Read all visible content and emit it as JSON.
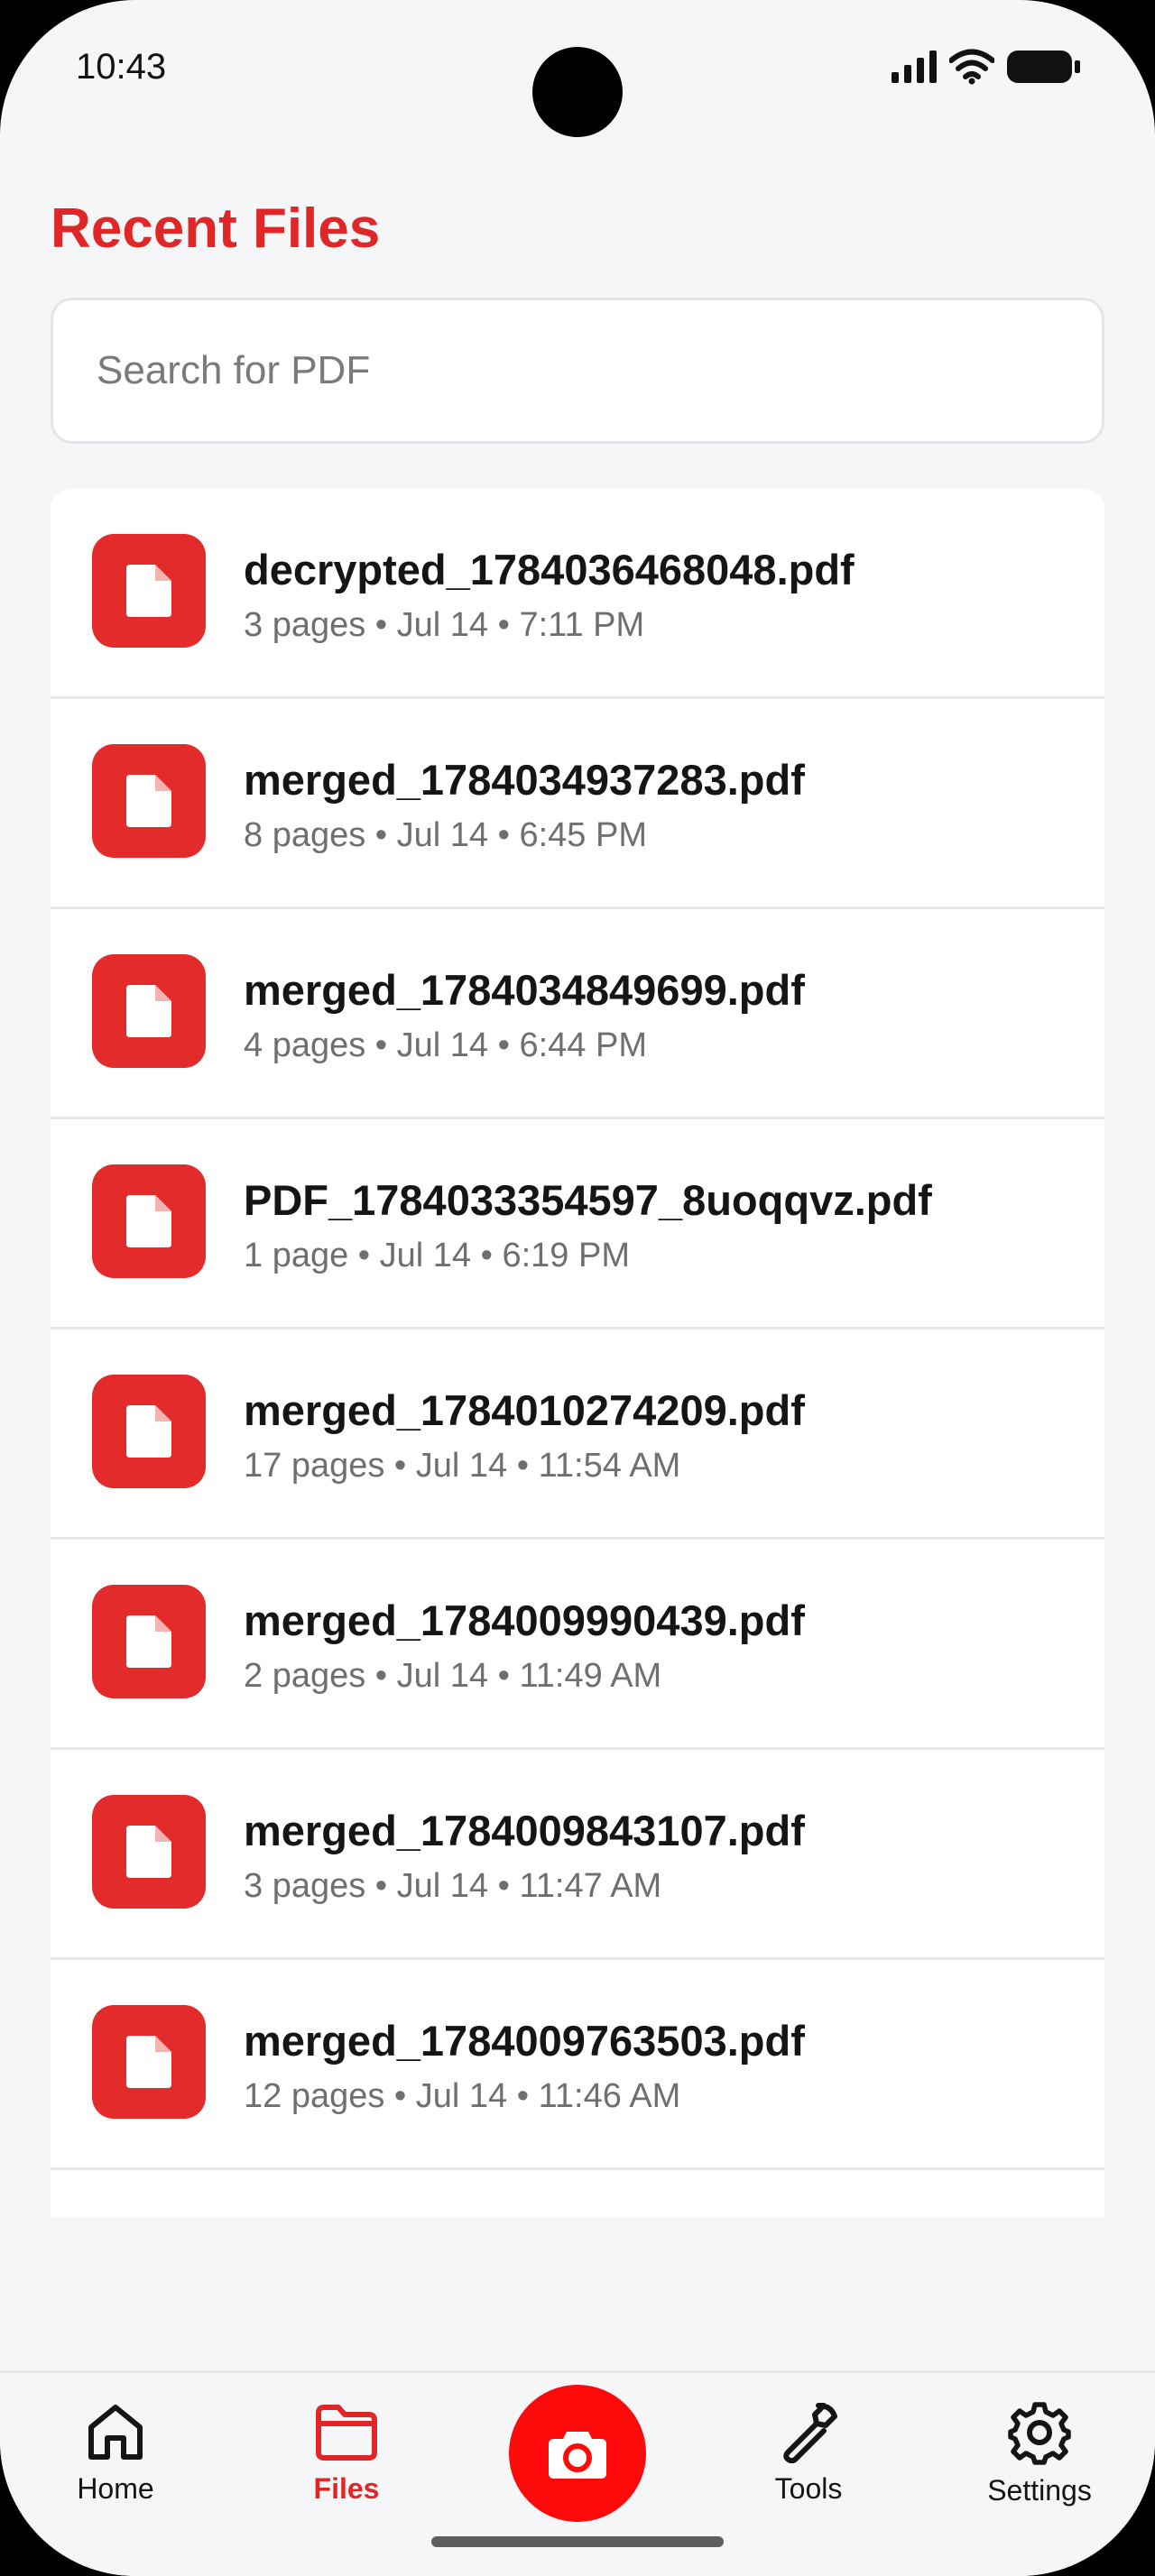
{
  "status_bar": {
    "time": "10:43"
  },
  "header": {
    "title": "Recent Files"
  },
  "search": {
    "placeholder": "Search for PDF"
  },
  "files": [
    {
      "name": "decrypted_1784036468048.pdf",
      "meta": "3 pages • Jul 14 • 7:11 PM"
    },
    {
      "name": "merged_1784034937283.pdf",
      "meta": "8 pages • Jul 14 • 6:45 PM"
    },
    {
      "name": "merged_1784034849699.pdf",
      "meta": "4 pages • Jul 14 • 6:44 PM"
    },
    {
      "name": "PDF_1784033354597_8uoqqvz.pdf",
      "meta": "1 page • Jul 14 • 6:19 PM"
    },
    {
      "name": "merged_1784010274209.pdf",
      "meta": "17 pages • Jul 14 • 11:54 AM"
    },
    {
      "name": "merged_1784009990439.pdf",
      "meta": "2 pages • Jul 14 • 11:49 AM"
    },
    {
      "name": "merged_1784009843107.pdf",
      "meta": "3 pages • Jul 14 • 11:47 AM"
    },
    {
      "name": "merged_1784009763503.pdf",
      "meta": "12 pages • Jul 14 • 11:46 AM"
    }
  ],
  "nav": {
    "home": "Home",
    "files": "Files",
    "tools": "Tools",
    "settings": "Settings",
    "active": "files"
  },
  "colors": {
    "accent": "#e02626",
    "file_icon_bg": "#e32b2b",
    "camera_button": "#ff0a0a"
  },
  "icons": {
    "file": "pdf-file-icon",
    "camera": "camera-icon",
    "home": "home-icon",
    "files": "folder-icon",
    "tools": "wrench-icon",
    "settings": "gear-icon"
  }
}
